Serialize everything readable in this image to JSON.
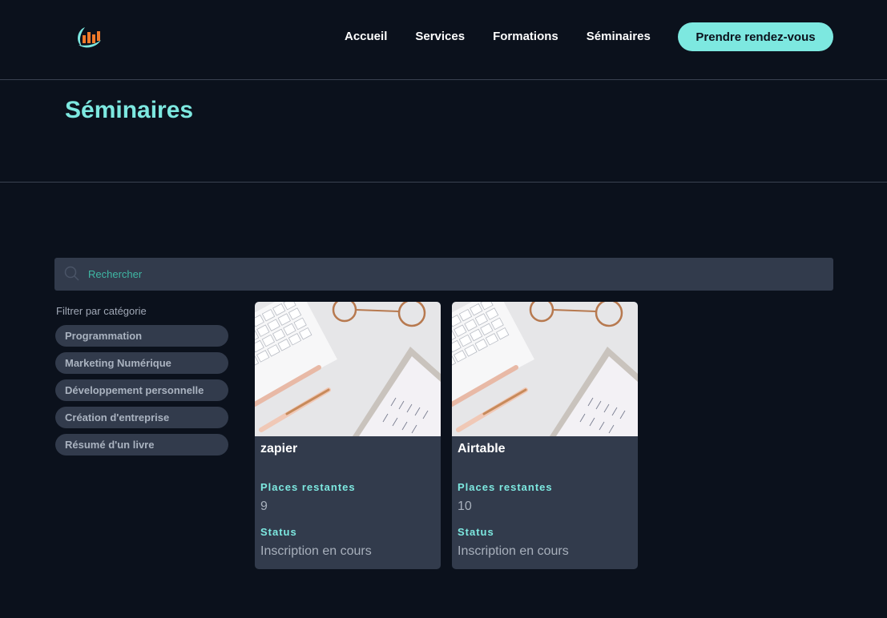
{
  "header": {
    "nav": [
      "Accueil",
      "Services",
      "Formations",
      "Séminaires"
    ],
    "cta_label": "Prendre rendez-vous"
  },
  "page": {
    "title": "Séminaires"
  },
  "search": {
    "placeholder": "Rechercher",
    "value": ""
  },
  "filters": {
    "label": "Filtrer par catégorie",
    "categories": [
      "Programmation",
      "Marketing Numérique",
      "Développement personnelle",
      "Création d'entreprise",
      "Résumé d'un livre"
    ]
  },
  "seminars": [
    {
      "title": "zapier",
      "places_label": "Places restantes",
      "places": "9",
      "status_label": "Status",
      "status": "Inscription en cours"
    },
    {
      "title": "Airtable",
      "places_label": "Places restantes",
      "places": "10",
      "status_label": "Status",
      "status": "Inscription en cours"
    }
  ],
  "colors": {
    "accent": "#7de8e0",
    "background": "#0b111c",
    "surface": "#323b4c",
    "search_placeholder": "#3fb7a4"
  }
}
